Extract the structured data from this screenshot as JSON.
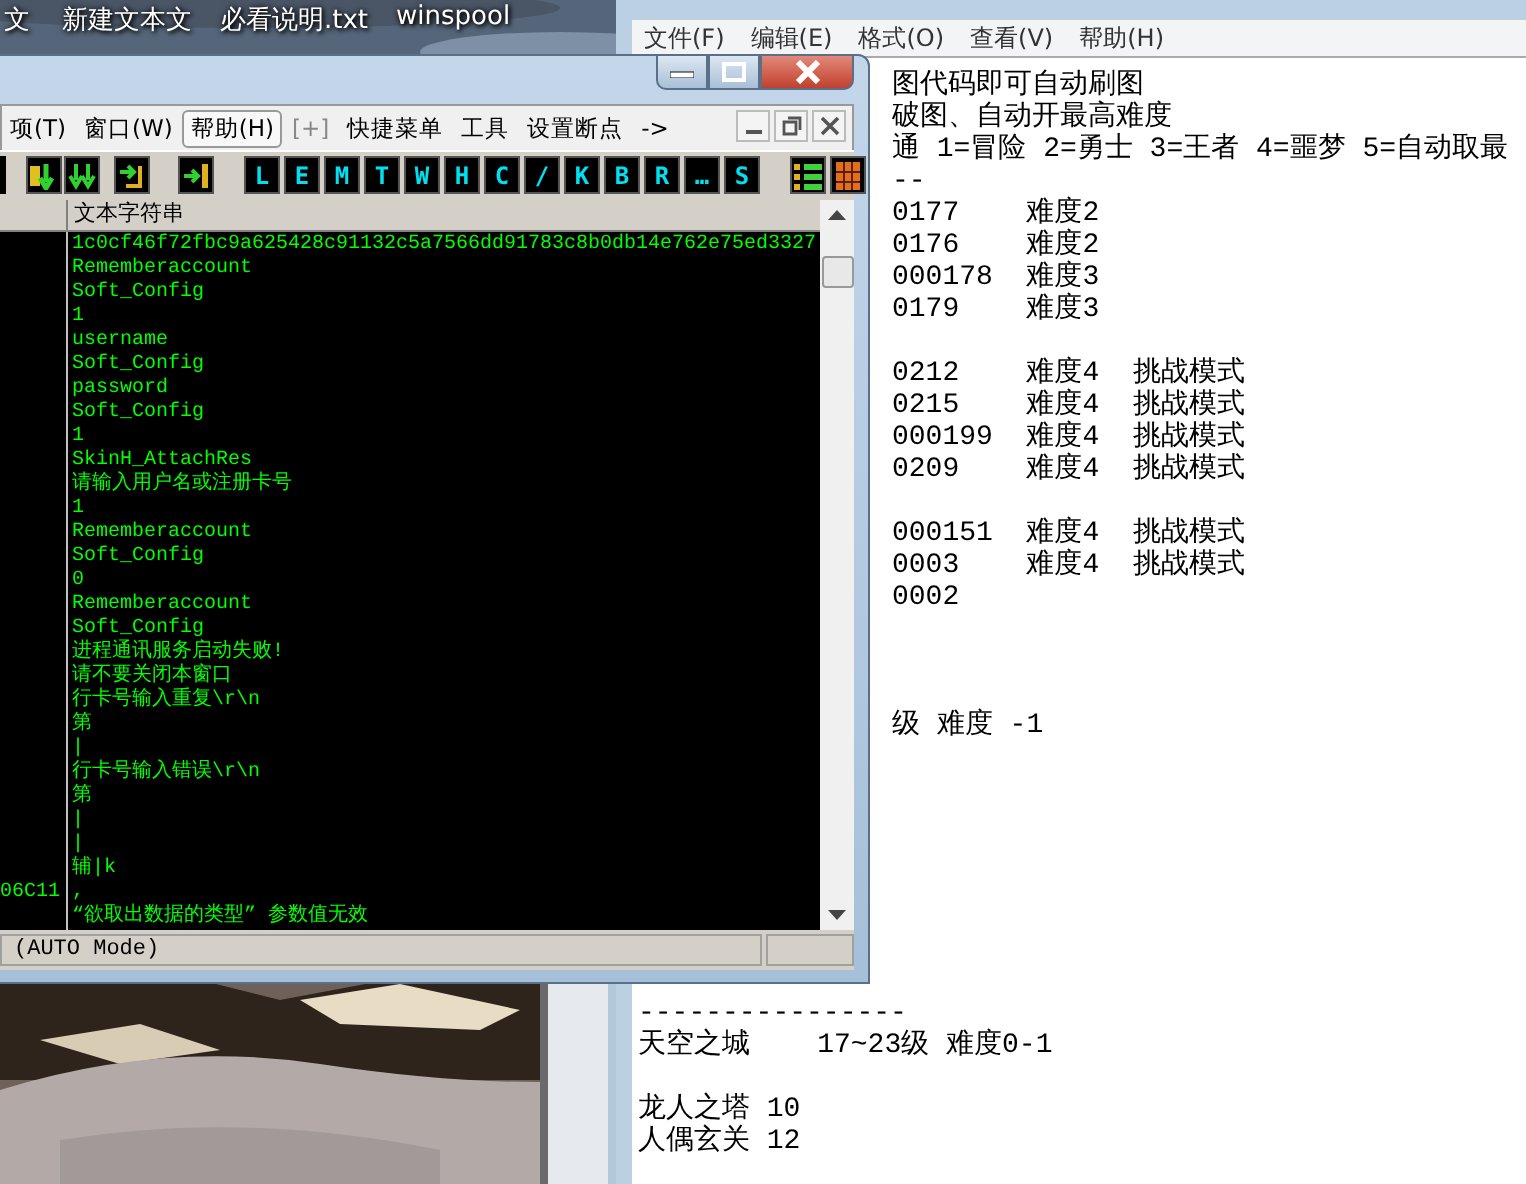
{
  "desktop": {
    "icons": [
      {
        "label": "文"
      },
      {
        "label": "新建文本文"
      },
      {
        "label": "必看说明.txt"
      },
      {
        "label": "winspool"
      }
    ]
  },
  "debugger": {
    "menu": [
      {
        "label": "项(T)",
        "selected": false,
        "disabled": false
      },
      {
        "label": "窗口(W)",
        "selected": false,
        "disabled": false
      },
      {
        "label": "帮助(H)",
        "selected": true,
        "disabled": false
      },
      {
        "label": "[+]",
        "selected": false,
        "disabled": true
      },
      {
        "label": "快捷菜单",
        "selected": false,
        "disabled": false
      },
      {
        "label": "工具",
        "selected": false,
        "disabled": false
      },
      {
        "label": "设置断点",
        "selected": false,
        "disabled": false
      },
      {
        "label": "->",
        "selected": false,
        "disabled": false
      }
    ],
    "toolbar_letters": [
      "L",
      "E",
      "M",
      "T",
      "W",
      "H",
      "C",
      "/",
      "K",
      "B",
      "R",
      "…",
      "S"
    ],
    "column_header": "文本字符串",
    "rows": [
      {
        "text": "1c0cf46f72fbc9a625428c91132c5a7566dd91783c8b0db14e762e75ed3327"
      },
      {
        "text": "Rememberaccount"
      },
      {
        "text": "Soft_Config"
      },
      {
        "text": "1"
      },
      {
        "text": "username"
      },
      {
        "text": "Soft_Config"
      },
      {
        "text": "password"
      },
      {
        "text": "Soft_Config"
      },
      {
        "text": "1"
      },
      {
        "text": "SkinH_AttachRes"
      },
      {
        "text": "请输入用户名或注册卡号"
      },
      {
        "text": "1"
      },
      {
        "text": "Rememberaccount"
      },
      {
        "text": "Soft_Config"
      },
      {
        "text": "0"
      },
      {
        "text": "Rememberaccount"
      },
      {
        "text": "Soft_Config"
      },
      {
        "text": "进程通讯服务启动失败!"
      },
      {
        "text": "请不要关闭本窗口"
      },
      {
        "text": "行卡号输入重复\\r\\n"
      },
      {
        "text": "第"
      },
      {
        "text": "|"
      },
      {
        "text": "行卡号输入错误\\r\\n"
      },
      {
        "text": "第"
      },
      {
        "text": "|"
      },
      {
        "text": "|"
      },
      {
        "text": "辅|k"
      },
      {
        "address": "06C11",
        "text": ","
      },
      {
        "text": "“欲取出数据的类型” 参数值无效"
      }
    ],
    "status": "(AUTO Mode)"
  },
  "notepad": {
    "menu": [
      "文件(F)",
      "编辑(E)",
      "格式(O)",
      "查看(V)",
      "帮助(H)"
    ],
    "upper_groups": [
      [
        "图代码即可自动刷图",
        "破图、自动开最高难度",
        "通 1=冒险 2=勇士 3=王者 4=噩梦 5=自动取最",
        "--",
        "0177    难度2",
        "0176    难度2",
        "000178  难度3",
        "0179    难度3"
      ],
      [
        "0212    难度4  挑战模式",
        "0215    难度4  挑战模式",
        "000199  难度4  挑战模式",
        "0209    难度4  挑战模式"
      ],
      [
        "000151  难度4  挑战模式",
        "0003    难度4  挑战模式",
        "0002"
      ]
    ],
    "upper_note": "级 难度 -1",
    "lower_groups": [
      [
        "----------------",
        "天空之城    17~23级 难度0-1"
      ],
      [
        "龙人之塔 10",
        "人偶玄关 12"
      ]
    ]
  }
}
